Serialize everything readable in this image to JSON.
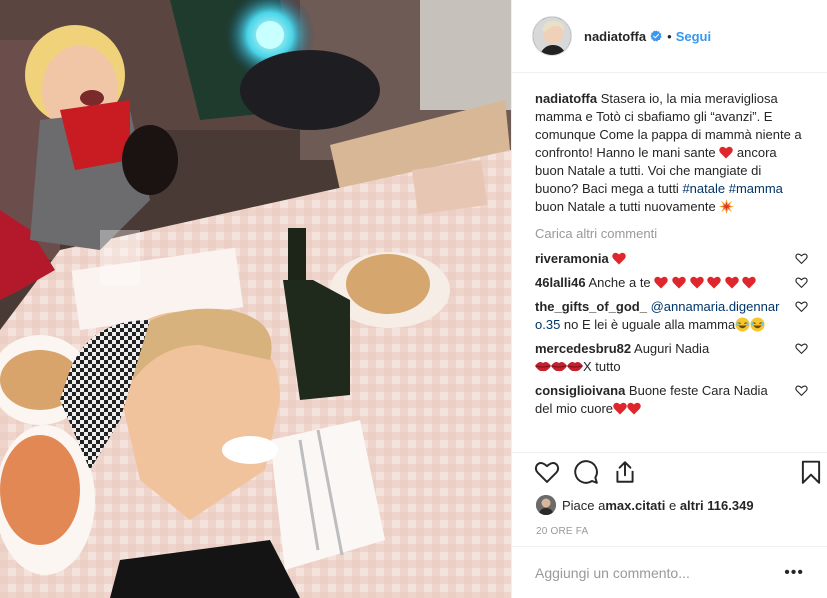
{
  "post": {
    "author": "nadiatoffa",
    "follow_label": "Segui",
    "dot": "•",
    "caption": {
      "username": "nadiatoffa",
      "part1": " Stasera io, la mia meravigliosa mamma e Totò ci sbafiamo gli “avanzi”. E comunque Come la pappa di mammà niente a confronto! Hanno le mani sante ",
      "part2": " ancora buon Natale a tutti. Voi che mangiate di buono? Baci mega a tutti ",
      "hashtag1": "#natale",
      "space": " ",
      "hashtag2": "#mamma",
      "part3": " buon Natale a tutti nuovamente "
    },
    "load_more_label": "Carica altri commenti",
    "comments": [
      {
        "username": "riveramonia",
        "text": " "
      },
      {
        "username": "46lalli46",
        "text": " Anche a te "
      },
      {
        "username": "the_gifts_of_god_",
        "mention": " @annamaria.digennaro.35",
        "text": " no E lei è uguale alla mamma"
      },
      {
        "username": "mercedesbru82",
        "text": " Auguri Nadia",
        "text2": "X tutto"
      },
      {
        "username": "consiglioivana",
        "text": " Buone feste Cara Nadia del mio cuore"
      }
    ],
    "likes": {
      "prefix": "Piace a ",
      "first_user": "max.citati",
      "middle": " e ",
      "others": "altri 116.349"
    },
    "time": "20 ORE FA",
    "add_comment_placeholder": "Aggiungi un commento...",
    "more_label": "•••"
  },
  "icons": {
    "verified": "verified-badge-icon",
    "like": "heart-outline-icon",
    "comment": "speech-bubble-icon",
    "share": "share-icon",
    "save": "bookmark-icon"
  },
  "colors": {
    "link_blue": "#3897f0",
    "hashtag": "#003569",
    "muted": "#999999",
    "heart_red": "#ed4956"
  }
}
